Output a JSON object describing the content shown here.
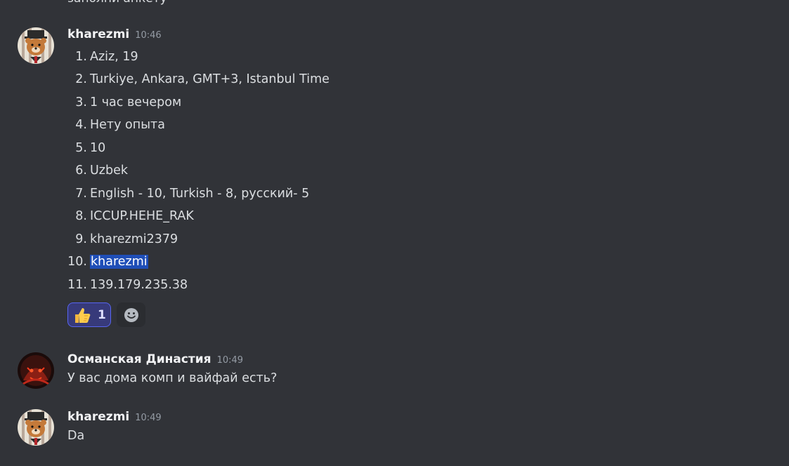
{
  "partial_top": {
    "text": "заполни анкету"
  },
  "messages": [
    {
      "username": "kharezmi",
      "time": "10:46",
      "list": [
        {
          "n": "1.",
          "text": "Aziz, 19"
        },
        {
          "n": "2.",
          "text": "Turkiye, Ankara, GMT+3, Istanbul Time"
        },
        {
          "n": "3.",
          "text": "1 час вечером"
        },
        {
          "n": "4.",
          "text": "Нету опыта"
        },
        {
          "n": "5.",
          "text": "10"
        },
        {
          "n": "6.",
          "text": "Uzbek"
        },
        {
          "n": "7.",
          "text": "English - 10, Turkish - 8, русский- 5"
        },
        {
          "n": "8.",
          "text": "ICCUP.HEHE_RAK"
        },
        {
          "n": "9.",
          "text": "kharezmi2379"
        },
        {
          "n": "10.",
          "text": "kharezmi"
        },
        {
          "n": "11.",
          "text": "139.179.235.38"
        }
      ],
      "reaction": {
        "emoji": "thumbs-up",
        "count": "1"
      }
    },
    {
      "username": "Османская Династия",
      "time": "10:49",
      "text": "У вас дома комп и вайфай есть?"
    },
    {
      "username": "kharezmi",
      "time": "10:49",
      "text": "Da"
    }
  ],
  "colors": {
    "background": "#313338",
    "text": "#dbdee1",
    "username": "#f2f3f5",
    "timestamp": "#949ba4",
    "selection": "#1f4eb7",
    "reaction_border": "#5865f2",
    "reaction_bg": "#373a7a"
  }
}
